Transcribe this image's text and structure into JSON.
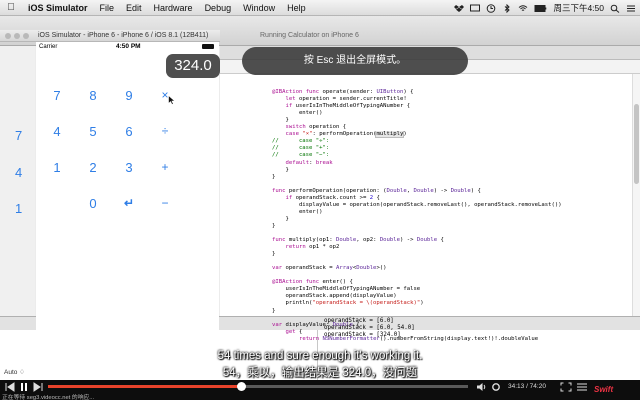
{
  "menubar": {
    "app_name": "iOS Simulator",
    "items": [
      "File",
      "Edit",
      "Hardware",
      "Debug",
      "Window",
      "Help"
    ],
    "clock": "周三下午4:50"
  },
  "simulator": {
    "window_title": "iOS Simulator - iPhone 6 - iPhone 6 / iOS 8.1 (12B411)",
    "status": {
      "carrier": "Carrier",
      "time": "4:50 PM"
    },
    "display_value": "324.0",
    "keys": [
      {
        "label": "7",
        "type": "digit"
      },
      {
        "label": "8",
        "type": "digit"
      },
      {
        "label": "9",
        "type": "digit"
      },
      {
        "label": "×",
        "type": "op"
      },
      {
        "label": "4",
        "type": "digit"
      },
      {
        "label": "5",
        "type": "digit"
      },
      {
        "label": "6",
        "type": "digit"
      },
      {
        "label": "÷",
        "type": "op"
      },
      {
        "label": "1",
        "type": "digit"
      },
      {
        "label": "2",
        "type": "digit"
      },
      {
        "label": "3",
        "type": "digit"
      },
      {
        "label": "+",
        "type": "op"
      },
      {
        "label": "0",
        "type": "digit"
      },
      {
        "label": "↵",
        "type": "enter"
      },
      {
        "label": "−",
        "type": "op"
      }
    ],
    "background_digits": [
      "7",
      "4",
      "1"
    ]
  },
  "xcode": {
    "toolbar_text": "Running Calculator on iPhone 6",
    "debug_area": {
      "auto_label": "Auto ♢"
    },
    "console_lines": [
      "operandStack = [6.0]",
      "operandStack = [6.0, 54.0]",
      "operandStack = [324.0]"
    ],
    "code_lines": [
      "",
      "@IBAction func operate(sender: UIButton) {",
      "    let operation = sender.currentTitle!",
      "    if userIsInTheMiddleOfTypingANumber {",
      "        enter()",
      "    }",
      "    switch operation {",
      "    case \"×\": performOperation(multiply)",
      "//      case \"÷\":",
      "//      case \"+\":",
      "//      case \"−\":",
      "    default: break",
      "    }",
      "}",
      "",
      "func performOperation(operation: (Double, Double) -> Double) {",
      "    if operandStack.count >= 2 {",
      "        displayValue = operation(operandStack.removeLast(), operandStack.removeLast())",
      "        enter()",
      "    }",
      "}",
      "",
      "func multiply(op1: Double, op2: Double) -> Double {",
      "    return op1 * op2",
      "}",
      "",
      "var operandStack = Array<Double>()",
      "",
      "@IBAction func enter() {",
      "    userIsInTheMiddleOfTypingANumber = false",
      "    operandStack.append(displayValue)",
      "    println(\"operandStack = \\(operandStack)\")",
      "}",
      "",
      "var displayValue: Double {",
      "    get {",
      "        return NSNumberFormatter().numberFromString(display.text!)!.doubleValue"
    ]
  },
  "overlay": {
    "esc_message": "按 Esc 退出全屏模式。",
    "subtitle_en": "54 times and sure enough it's working it.",
    "subtitle_zh": "54，乘以，输出结果是 324.0，没问题"
  },
  "player": {
    "time": "34:13 / 74:20",
    "progress": 0.4603,
    "status_url": "正在等待 seg3.videocc.net 的响应...",
    "brand": "Swift"
  },
  "colors": {
    "calc_blue": "#2f7ee6",
    "progress_red": "#e8432b",
    "keyword_purple": "#aa0d91",
    "string_red": "#c41a16",
    "comment_green": "#007400"
  }
}
